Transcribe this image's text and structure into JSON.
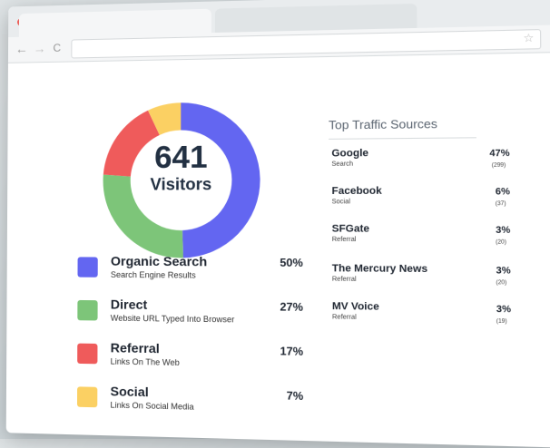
{
  "browser": {
    "nav_back": "←",
    "nav_forward": "→",
    "nav_reload": "C",
    "address": "",
    "star": "☆",
    "menu": "≡"
  },
  "colors": {
    "close": "#ec5f58",
    "minimize": "#f4be4f",
    "maximize": "#61c454",
    "organic": "#6366f1",
    "direct": "#7dc579",
    "referral": "#ef5b5b",
    "social": "#fbd063"
  },
  "visitors": {
    "count": "641",
    "label": "Visitors"
  },
  "breakdown": [
    {
      "title": "Organic Search",
      "subtitle": "Search Engine Results",
      "percent": "50%",
      "value": 50,
      "color": "#6366f1"
    },
    {
      "title": "Direct",
      "subtitle": "Website URL Typed Into Browser",
      "percent": "27%",
      "value": 27,
      "color": "#7dc579"
    },
    {
      "title": "Referral",
      "subtitle": "Links On The Web",
      "percent": "17%",
      "value": 17,
      "color": "#ef5b5b"
    },
    {
      "title": "Social",
      "subtitle": "Links On Social Media",
      "percent": "7%",
      "value": 7,
      "color": "#fbd063"
    }
  ],
  "top_sources": {
    "title": "Top Traffic Sources",
    "items": [
      {
        "name": "Google",
        "type": "Search",
        "percent": "47%",
        "count": "(299)"
      },
      {
        "name": "Facebook",
        "type": "Social",
        "percent": "6%",
        "count": "(37)"
      },
      {
        "name": "SFGate",
        "type": "Referral",
        "percent": "3%",
        "count": "(20)"
      },
      {
        "name": "The Mercury News",
        "type": "Referral",
        "percent": "3%",
        "count": "(20)"
      },
      {
        "name": "MV Voice",
        "type": "Referral",
        "percent": "3%",
        "count": "(19)"
      }
    ]
  }
}
